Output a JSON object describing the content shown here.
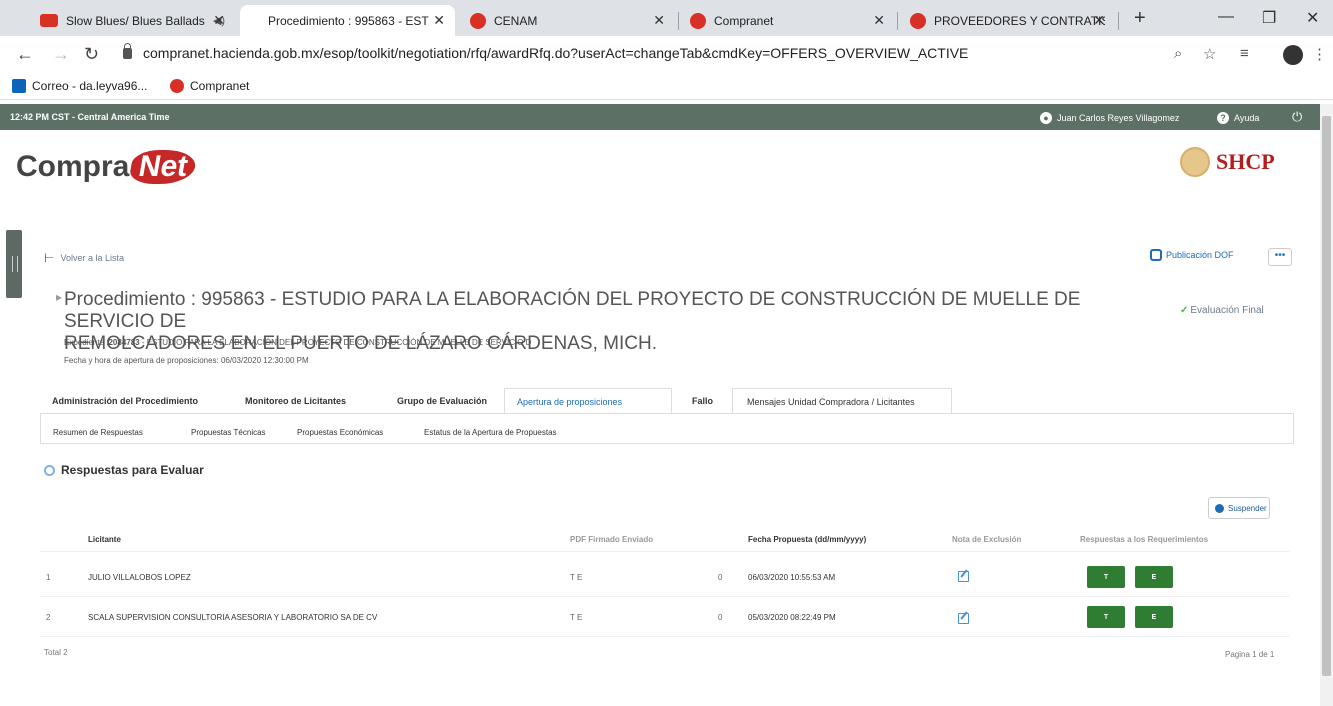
{
  "browser": {
    "tabs": [
      {
        "label": "Slow Blues/ Blues Ballads",
        "icon": "youtube-icon"
      },
      {
        "label": "Procedimiento : 995863 - EST",
        "icon": "none"
      },
      {
        "label": "CENAM",
        "icon": "red-dot-icon"
      },
      {
        "label": "Compranet",
        "icon": "red-dot-icon"
      },
      {
        "label": "PROVEEDORES Y CONTRATIST",
        "icon": "red-dot-icon"
      }
    ],
    "url": "compranet.hacienda.gob.mx/esop/toolkit/negotiation/rfq/awardRfq.do?userAct=changeTab&cmdKey=OFFERS_OVERVIEW_ACTIVE",
    "bookmarks": [
      {
        "label": "Correo - da.leyva96..."
      },
      {
        "label": "Compranet"
      }
    ]
  },
  "header": {
    "time": "12:42 PM CST - Central America Time",
    "user": "Juan Carlos Reyes Villagomez",
    "help": "Ayuda",
    "logo_left": "Compra",
    "logo_right": "Net",
    "shcp": "SHCP"
  },
  "page": {
    "back_link": "Volver a la Lista",
    "dof_link": "Publicación DOF",
    "more": "•••",
    "title_line1": "Procedimiento : 995863 - ESTUDIO PARA LA ELABORACIÓN DEL PROYECTO DE CONSTRUCCIÓN DE MUELLE DE SERVICIO DE",
    "title_line2": "REMOLCADORES EN EL PUERTO DE LÁZARO CÁRDENAS, MICH.",
    "status": "Evaluación Final",
    "expediente_label": "Expediente :",
    "expediente_num": "2084783",
    "expediente_desc": " - ESTUDIO PARA LA ELABORACIÓN DEL PROYECTO DE CONSTRUCCIÓN DE MUELLE DE SERVICIO D",
    "fecha_apertura": "Fecha y hora de apertura de proposiciones: 06/03/2020 12:30:00 PM",
    "tabs": [
      "Administración del Procedimiento",
      "Monitoreo de Licitantes",
      "Grupo de Evaluación",
      "Apertura de proposiciones",
      "Fallo",
      "Mensajes Unidad Compradora / Licitantes"
    ],
    "subtabs": [
      "Resumen de Respuestas",
      "Propuestas Técnicas",
      "Propuestas Económicas",
      "Estatus de la Apertura de Propuestas"
    ],
    "section_title": "Respuestas para Evaluar",
    "suspend": "Suspender"
  },
  "table": {
    "headers": {
      "licitante": "Licitante",
      "pdf": "PDF Firmado Enviado",
      "fecha": "Fecha Propuesta (dd/mm/yyyy)",
      "nota": "Nota de Exclusión",
      "respuestas": "Respuestas a los Requerimientos"
    },
    "rows": [
      {
        "idx": "1",
        "licitante": "JULIO VILLALOBOS LOPEZ",
        "pdf": "T E",
        "count": "0",
        "fecha": "06/03/2020 10:55:53 AM",
        "btn_t": "T",
        "btn_e": "E"
      },
      {
        "idx": "2",
        "licitante": "SCALA SUPERVISION CONSULTORIA ASESORIA Y LABORATORIO SA DE CV",
        "pdf": "T E",
        "count": "0",
        "fecha": "05/03/2020 08:22:49 PM",
        "btn_t": "T",
        "btn_e": "E"
      }
    ],
    "total": "Total 2",
    "pagina": "Pagina 1 de 1"
  }
}
